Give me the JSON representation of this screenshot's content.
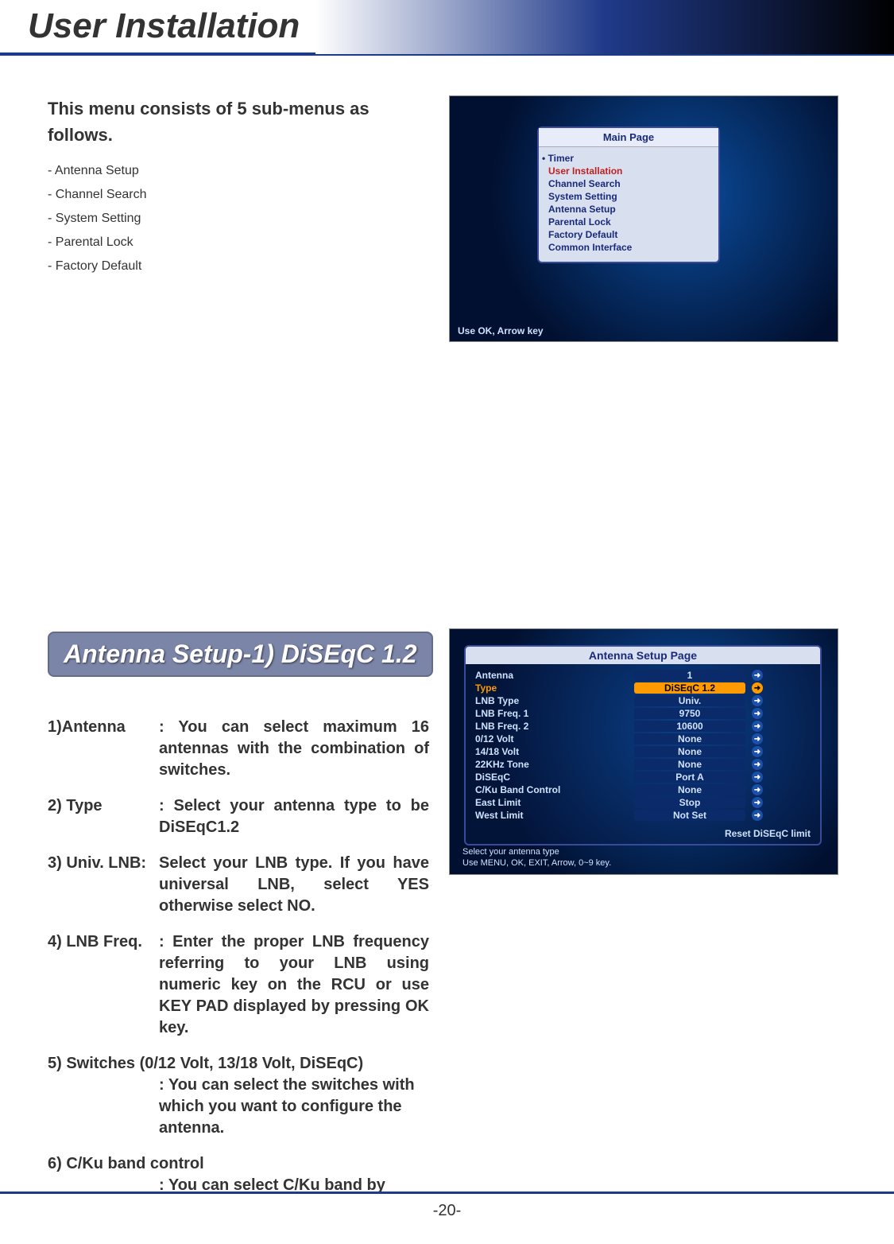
{
  "header": {
    "title": "User Installation"
  },
  "intro": {
    "lead": "This menu consists of 5 sub-menus as follows.",
    "items": [
      "- Antenna Setup",
      "- Channel Search",
      "- System Setting",
      "- Parental Lock",
      "- Factory Default"
    ]
  },
  "screenshot1": {
    "title": "Main Page",
    "timer": "• Timer",
    "items": [
      "User Installation",
      "Channel Search",
      "System Setting",
      "Antenna Setup",
      "Parental Lock",
      "Factory Default",
      "Common Interface"
    ],
    "selected_index": 0,
    "hint": "Use OK, Arrow key"
  },
  "section_header": "Antenna Setup-1) DiSEqC 1.2",
  "defs": [
    {
      "label": "1)Antenna",
      "desc": ": You can select maximum 16 antennas with the combination of switches."
    },
    {
      "label": "2) Type",
      "desc": ": Select your antenna type to be DiSEqC1.2"
    },
    {
      "label": "3)  Univ. LNB:",
      "desc": "Select your LNB type. If you have universal LNB, select YES otherwise select NO.",
      "merge": true
    },
    {
      "label": "4) LNB Freq.",
      "desc": ": Enter the proper LNB frequency referring to your LNB using numeric key on the RCU or use KEY PAD displayed by pressing OK key."
    },
    {
      "label": "5) Switches (0/12 Volt, 13/18 Volt, DiSEqC)",
      "desc": ": You can select the switches with which you want to configure the antenna.",
      "block": true
    },
    {
      "label": "6) C/Ku band control",
      "desc": ": You can select C/Ku band by selection of switch type.",
      "block": true
    }
  ],
  "screenshot2": {
    "title": "Antenna Setup Page",
    "rows": [
      {
        "k": "Antenna",
        "v": "1"
      },
      {
        "k": "Type",
        "v": "DiSEqC 1.2",
        "sel": true
      },
      {
        "k": "LNB Type",
        "v": "Univ."
      },
      {
        "k": "LNB Freq. 1",
        "v": "9750"
      },
      {
        "k": "LNB Freq. 2",
        "v": "10600"
      },
      {
        "k": "0/12 Volt",
        "v": "None"
      },
      {
        "k": "14/18 Volt",
        "v": "None"
      },
      {
        "k": "22KHz Tone",
        "v": "None"
      },
      {
        "k": "DiSEqC",
        "v": "Port A"
      },
      {
        "k": "C/Ku Band Control",
        "v": "None"
      },
      {
        "k": "East Limit",
        "v": "Stop"
      },
      {
        "k": "West Limit",
        "v": "Not Set"
      }
    ],
    "reset": "Reset DiSEqC limit",
    "hint1": "Select your antenna type",
    "hint2": "Use MENU, OK, EXIT, Arrow, 0~9 key."
  },
  "page_number": "-20-"
}
